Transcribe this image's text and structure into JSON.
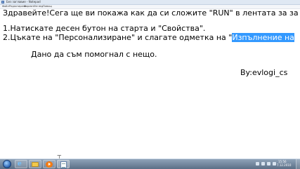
{
  "window": {
    "title": "Без заглавие - Notepad"
  },
  "menu": {
    "items": [
      "Файл",
      "Редактиране",
      "Формат",
      "Изглед",
      "Помощ"
    ]
  },
  "document": {
    "line1": "Здравейте!Сега ще ви покажа как да си сложите \"RUN\" в лентата за за",
    "line2": "1.Натискате десен бутон на старта и \"Свойства\".",
    "line3_prefix": "2.Цъкате на \"Персонализиране\" и слагате одметка на \"",
    "line3_selected": "Изпълнение на",
    "line4": "Дано да съм помогнал с нещо.",
    "signature": "By:evlogi_cs",
    "selection_color": "#3399ff"
  },
  "taskbar": {
    "pinned": [
      "internet-explorer-icon",
      "folder-icon",
      "media-player-icon",
      "notepad-icon"
    ],
    "clock_time": "15:56",
    "clock_date": "7.12.2010"
  }
}
